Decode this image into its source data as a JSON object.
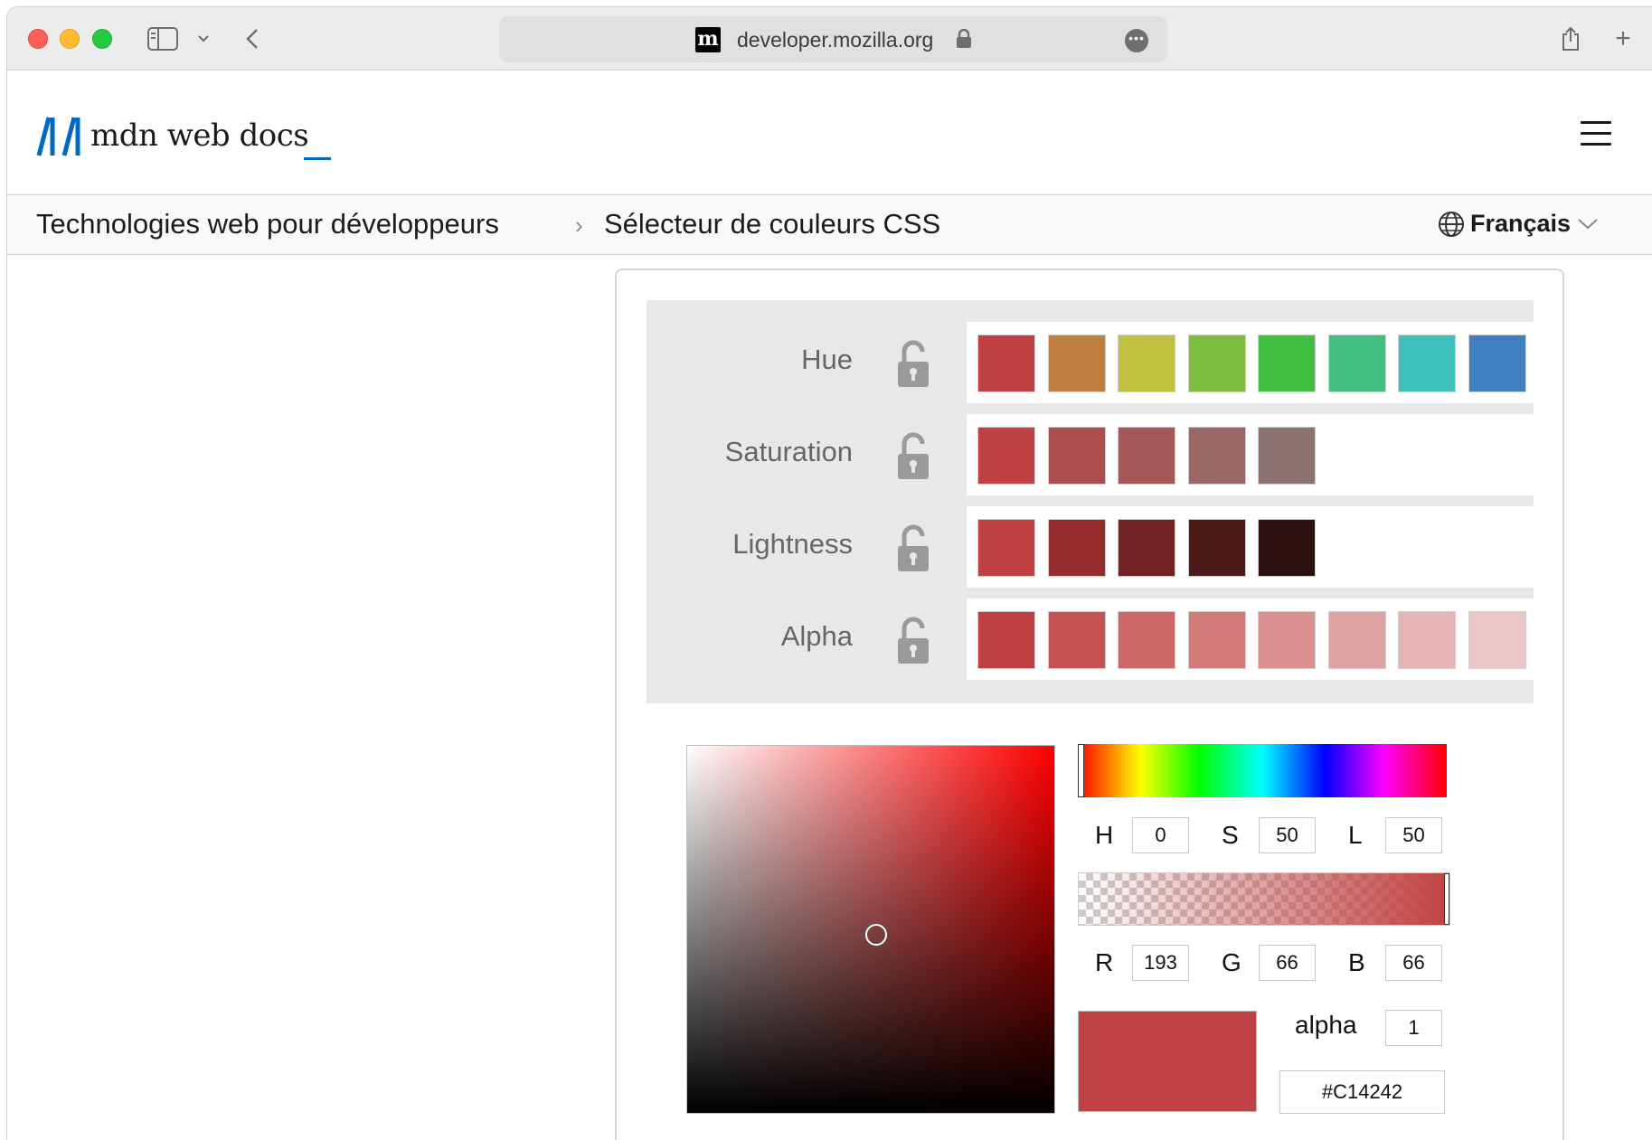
{
  "browser": {
    "url": "developer.mozilla.org",
    "favicon_letter": "m",
    "new_tab": "+"
  },
  "header": {
    "logo_text": "mdn web docs",
    "logo_color": "#0069c2"
  },
  "breadcrumbs": {
    "parent": "Technologies web pour développeurs",
    "separator": "›",
    "current": "Sélecteur de couleurs CSS",
    "language": "Français"
  },
  "palette": {
    "rows": [
      {
        "label": "Hue",
        "swatches": [
          "#bf4040",
          "#bf7f40",
          "#bfbf40",
          "#7fbf40",
          "#40bf40",
          "#40bf7f",
          "#40bfbf",
          "#4080bf"
        ]
      },
      {
        "label": "Saturation",
        "swatches": [
          "#bf4040",
          "#ac4e4e",
          "#a65959",
          "#9a6666",
          "#8d7272"
        ]
      },
      {
        "label": "Lightness",
        "swatches": [
          "#bf4040",
          "#942c2c",
          "#722424",
          "#4d1a1a",
          "#2b0e0e"
        ]
      },
      {
        "label": "Alpha",
        "swatches": [
          "#bf4040",
          "#c65353",
          "#cd6767",
          "#d37b7b",
          "#da8f8f",
          "#e0a3a3",
          "#e5b5b5",
          "#ebc7c7"
        ]
      }
    ]
  },
  "picker": {
    "hsl": {
      "h_label": "H",
      "h": "0",
      "s_label": "S",
      "s": "50",
      "l_label": "L",
      "l": "50"
    },
    "rgb": {
      "r_label": "R",
      "r": "193",
      "g_label": "G",
      "g": "66",
      "b_label": "B",
      "b": "66"
    },
    "alpha_label": "alpha",
    "alpha": "1",
    "hex": "#C14242",
    "preview_color": "#c14242"
  }
}
